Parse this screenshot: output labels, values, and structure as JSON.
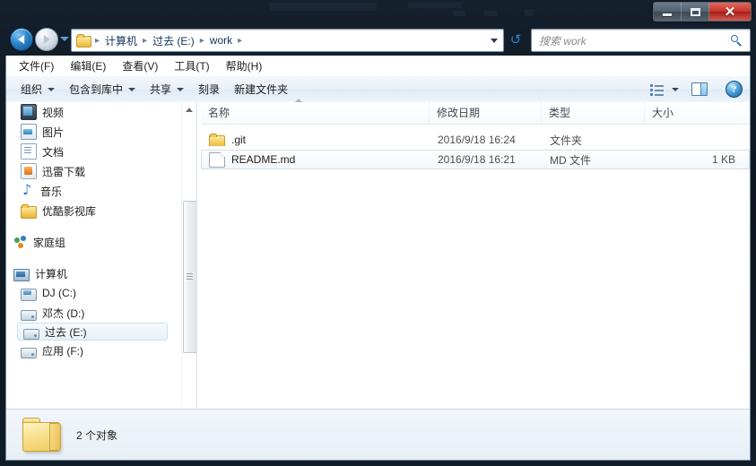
{
  "window": {
    "controls": {
      "minimize": "–",
      "maximize": "□",
      "close": "✕"
    }
  },
  "navbar": {
    "back_tooltip": "后退",
    "forward_tooltip": "前进",
    "breadcrumbs": [
      "计算机",
      "过去 (E:)",
      "work"
    ],
    "separator": "▸",
    "refresh_glyph": "↺",
    "search_placeholder": "搜索 work",
    "search_value": ""
  },
  "menubar": {
    "items": [
      "文件(F)",
      "编辑(E)",
      "查看(V)",
      "工具(T)",
      "帮助(H)"
    ]
  },
  "toolbar": {
    "items": [
      {
        "label": "组织",
        "has_caret": true
      },
      {
        "label": "包含到库中",
        "has_caret": true
      },
      {
        "label": "共享",
        "has_caret": true
      },
      {
        "label": "刻录",
        "has_caret": false
      },
      {
        "label": "新建文件夹",
        "has_caret": false
      }
    ],
    "help_glyph": "?"
  },
  "sidebar": {
    "items": [
      {
        "label": "视频",
        "icon": "video-icon",
        "icon_class": "ic-video",
        "level": 2,
        "selected": false
      },
      {
        "label": "图片",
        "icon": "pictures-icon",
        "icon_class": "ic-pic",
        "level": 2,
        "selected": false
      },
      {
        "label": "文档",
        "icon": "documents-icon",
        "icon_class": "ic-doc",
        "level": 2,
        "selected": false
      },
      {
        "label": "迅雷下载",
        "icon": "xunlei-download-icon",
        "icon_class": "ic-xunlei",
        "level": 2,
        "selected": false
      },
      {
        "label": "音乐",
        "icon": "music-icon",
        "icon_class": "ic-music",
        "level": 2,
        "selected": false
      },
      {
        "label": "优酷影视库",
        "icon": "folder-icon",
        "icon_class": "ic-folder",
        "level": 2,
        "selected": false
      },
      {
        "label": "家庭组",
        "icon": "homegroup-icon",
        "icon_class": "ic-home",
        "level": 1,
        "selected": false,
        "gap_before": true
      },
      {
        "label": "计算机",
        "icon": "computer-icon",
        "icon_class": "ic-computer",
        "level": 1,
        "selected": false,
        "gap_before": true
      },
      {
        "label": "DJ (C:)",
        "icon": "local-disk-icon",
        "icon_class": "ic-drive-c",
        "level": 2,
        "selected": false
      },
      {
        "label": "邓杰 (D:)",
        "icon": "drive-icon",
        "icon_class": "ic-drive",
        "level": 2,
        "selected": false
      },
      {
        "label": "过去 (E:)",
        "icon": "drive-icon",
        "icon_class": "ic-drive",
        "level": 2,
        "selected": true
      },
      {
        "label": "应用 (F:)",
        "icon": "drive-icon",
        "icon_class": "ic-drive",
        "level": 2,
        "selected": false
      }
    ]
  },
  "filelist": {
    "columns": [
      {
        "label": "名称",
        "key": "name"
      },
      {
        "label": "修改日期",
        "key": "date"
      },
      {
        "label": "类型",
        "key": "type"
      },
      {
        "label": "大小",
        "key": "size"
      }
    ],
    "sort_column": "名称",
    "sort_direction": "ascending",
    "rows": [
      {
        "name": ".git",
        "date": "2016/9/18 16:24",
        "type": "文件夹",
        "size": "",
        "icon": "folder-icon",
        "icon_class": "folder",
        "selected": false
      },
      {
        "name": "README.md",
        "date": "2016/9/18 16:21",
        "type": "MD 文件",
        "size": "1 KB",
        "icon": "file-icon",
        "icon_class": "file",
        "selected": true
      }
    ]
  },
  "statusbar": {
    "text": "2 个对象"
  },
  "colors": {
    "accent": "#2f7fc4",
    "close_button": "#c8352c",
    "folder_yellow": "#f4cd5e",
    "titlebar": "#101c26"
  }
}
